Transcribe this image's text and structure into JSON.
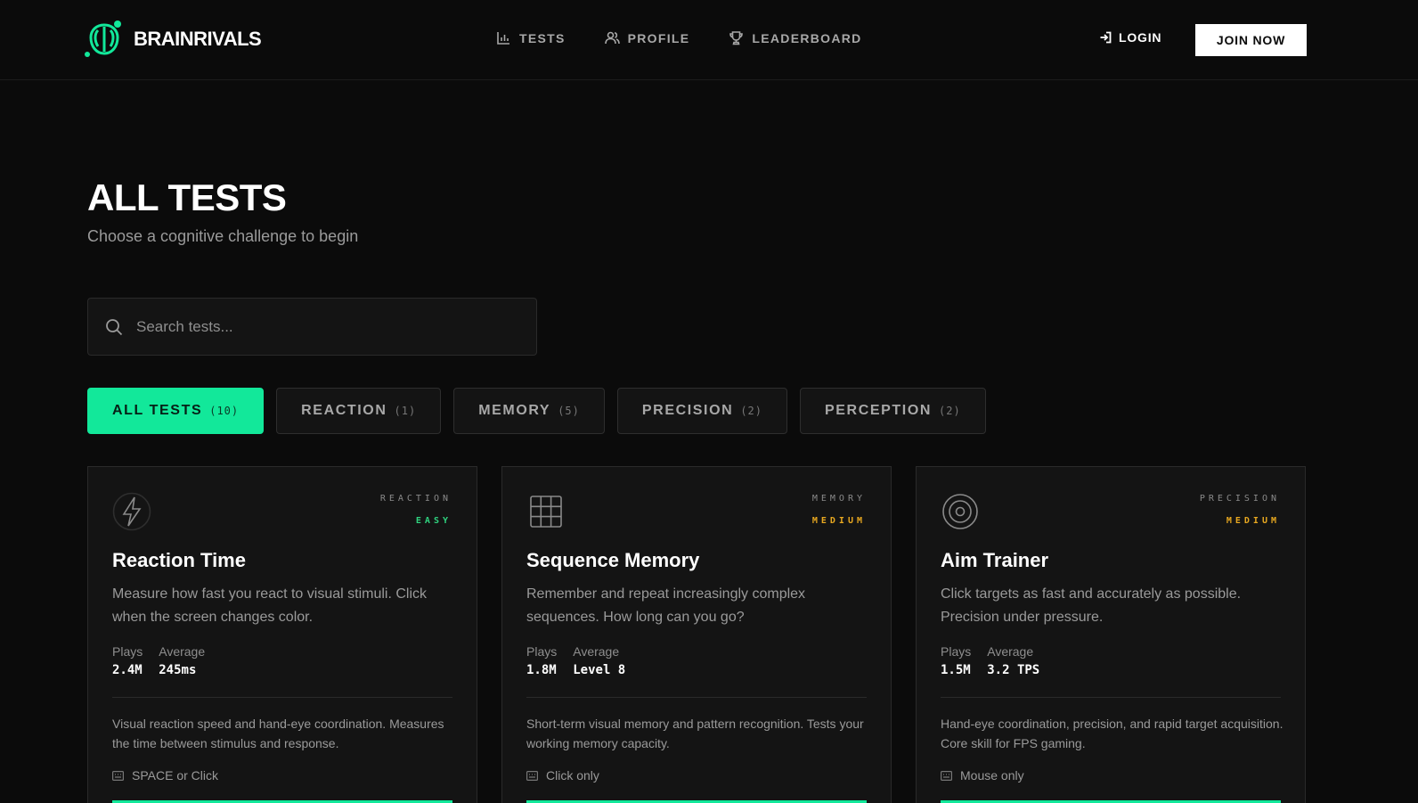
{
  "header": {
    "brand": "BRAINRIVALS",
    "nav": [
      {
        "label": "TESTS",
        "icon": "bar-chart-icon"
      },
      {
        "label": "PROFILE",
        "icon": "users-icon"
      },
      {
        "label": "LEADERBOARD",
        "icon": "trophy-icon"
      }
    ],
    "login_label": "LOGIN",
    "join_label": "JOIN NOW"
  },
  "main": {
    "title": "ALL TESTS",
    "subtitle": "Choose a cognitive challenge to begin",
    "search_placeholder": "Search tests...",
    "filters": [
      {
        "label": "ALL TESTS",
        "count": "(10)"
      },
      {
        "label": "REACTION",
        "count": "(1)"
      },
      {
        "label": "MEMORY",
        "count": "(5)"
      },
      {
        "label": "PRECISION",
        "count": "(2)"
      },
      {
        "label": "PERCEPTION",
        "count": "(2)"
      }
    ]
  },
  "cards": [
    {
      "icon": "lightning-icon",
      "category": "REACTION",
      "difficulty": "EASY",
      "title": "Reaction Time",
      "description": "Measure how fast you react to visual stimuli. Click when the screen changes color.",
      "plays_label": "Plays",
      "plays": "2.4M",
      "average_label": "Average",
      "average": "245ms",
      "details": "Visual reaction speed and hand-eye coordination. Measures the time between stimulus and response.",
      "input": "SPACE or Click"
    },
    {
      "icon": "grid-icon",
      "category": "MEMORY",
      "difficulty": "MEDIUM",
      "title": "Sequence Memory",
      "description": "Remember and repeat increasingly complex sequences. How long can you go?",
      "plays_label": "Plays",
      "plays": "1.8M",
      "average_label": "Average",
      "average": "Level 8",
      "details": "Short-term visual memory and pattern recognition. Tests your working memory capacity.",
      "input": "Click only"
    },
    {
      "icon": "target-icon",
      "category": "PRECISION",
      "difficulty": "MEDIUM",
      "title": "Aim Trainer",
      "description": "Click targets as fast and accurately as possible. Precision under pressure.",
      "plays_label": "Plays",
      "plays": "1.5M",
      "average_label": "Average",
      "average": "3.2 TPS",
      "details": "Hand-eye coordination, precision, and rapid target acquisition. Core skill for FPS gaming.",
      "input": "Mouse only"
    }
  ],
  "colors": {
    "accent": "#12e89a",
    "easy": "#2fd37f",
    "medium": "#e8a820",
    "background": "#0b0b0b",
    "card": "#141414"
  }
}
